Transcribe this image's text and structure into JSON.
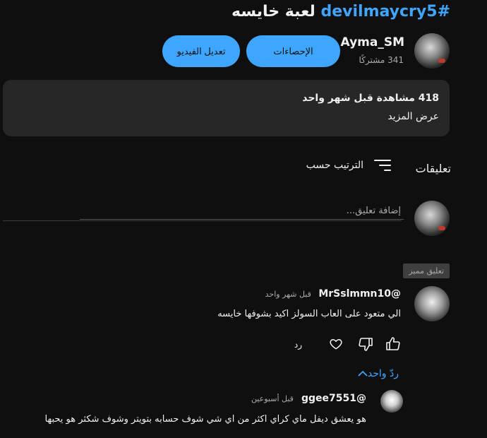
{
  "video": {
    "title_tag": "#devilmaycry5",
    "title_text": "لعبة خايسه"
  },
  "channel": {
    "name": "Ayma_SM",
    "subscribers": "341 مشتركًا"
  },
  "buttons": {
    "stats": "الإحصاءات",
    "edit_video": "تعديل الفيديو"
  },
  "description": {
    "views": "418 مشاهدة",
    "date": "قبل شهر واحد",
    "show_more": "عرض المزيد"
  },
  "comments": {
    "heading": "تعليقات",
    "sort_label": "الترتيب حسب",
    "add_placeholder": "إضافة تعليق...",
    "pinned_badge": "تعليق مميز",
    "items": [
      {
        "author": "@MrSslmmn10",
        "time": "قبل شهر واحد",
        "text": "الي متعود على العاب السولز اكيد بشوفها خايسه",
        "reply_label": "رد",
        "replies_toggle": "ردّ واحد"
      },
      {
        "author": "@ggee7551",
        "time": "قبل أسبوعين",
        "text": "هو يعشق ديفل ماي كراي اكثر من اي شي شوف حسابه بتويتر وشوف شكثر هو يحبها"
      }
    ]
  },
  "icons": {
    "like": "thumbs-up-icon",
    "dislike": "thumbs-down-icon",
    "heart": "heart-icon",
    "sort": "sort-icon",
    "chevron": "chevron-up-icon"
  },
  "colors": {
    "background": "#0f0f0f",
    "accent": "#3ea6ff",
    "panel": "#272727"
  }
}
